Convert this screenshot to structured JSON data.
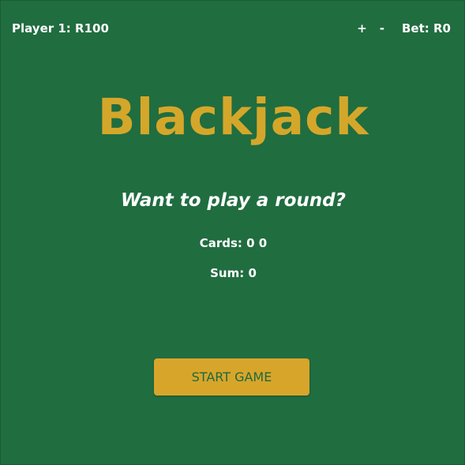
{
  "player": {
    "label": "Player 1: R100"
  },
  "bet": {
    "increase_label": "+",
    "decrease_label": "-",
    "label": "Bet: R0"
  },
  "game": {
    "title": "Blackjack",
    "message": "Want to play a round?",
    "cards_text": "Cards: 0 0",
    "sum_text": "Sum: 0",
    "start_label": "START GAME"
  },
  "colors": {
    "table_green": "#206d40",
    "accent_gold": "#d4a72a",
    "text_white": "#ffffff",
    "button_text": "#1e6a3d"
  }
}
